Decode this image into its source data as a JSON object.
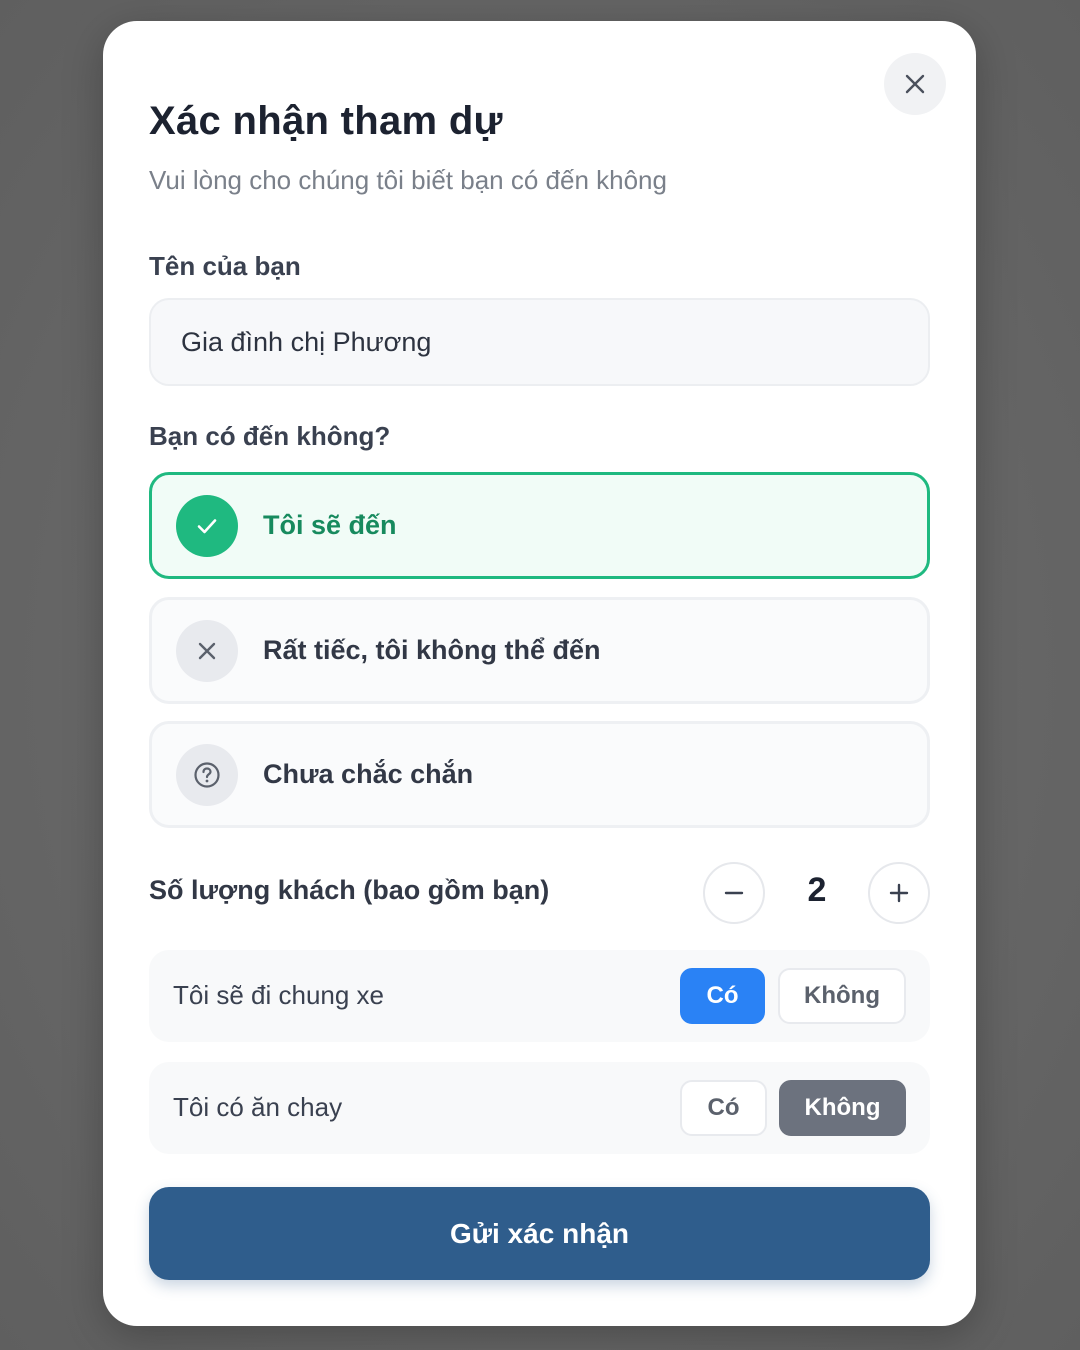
{
  "dialog": {
    "title": "Xác nhận tham dự",
    "subtitle": "Vui lòng cho chúng tôi biết bạn có đến không",
    "close_icon": "close-icon"
  },
  "name_field": {
    "label": "Tên của bạn",
    "value": "Gia đình chị Phương"
  },
  "attendance": {
    "question": "Bạn có đến không?",
    "selected": "yes",
    "options": [
      {
        "key": "yes",
        "label": "Tôi sẽ đến",
        "icon": "check-icon"
      },
      {
        "key": "no",
        "label": "Rất tiếc, tôi không thể đến",
        "icon": "x-icon"
      },
      {
        "key": "maybe",
        "label": "Chưa chắc chắn",
        "icon": "question-icon"
      }
    ]
  },
  "guests": {
    "label": "Số lượng khách (bao gồm bạn)",
    "value": "2",
    "minus_icon": "minus-icon",
    "plus_icon": "plus-icon"
  },
  "carpool": {
    "label": "Tôi sẽ đi chung xe",
    "yes_label": "Có",
    "no_label": "Không",
    "selected": "yes"
  },
  "vegetarian": {
    "label": "Tôi có ăn chay",
    "yes_label": "Có",
    "no_label": "Không",
    "selected": "no"
  },
  "submit": {
    "label": "Gửi xác nhận"
  },
  "colors": {
    "accent_green": "#1fb980",
    "accent_blue": "#2a82f5",
    "submit_bg": "#2f5d8c",
    "selected_gray": "#6c727e"
  }
}
